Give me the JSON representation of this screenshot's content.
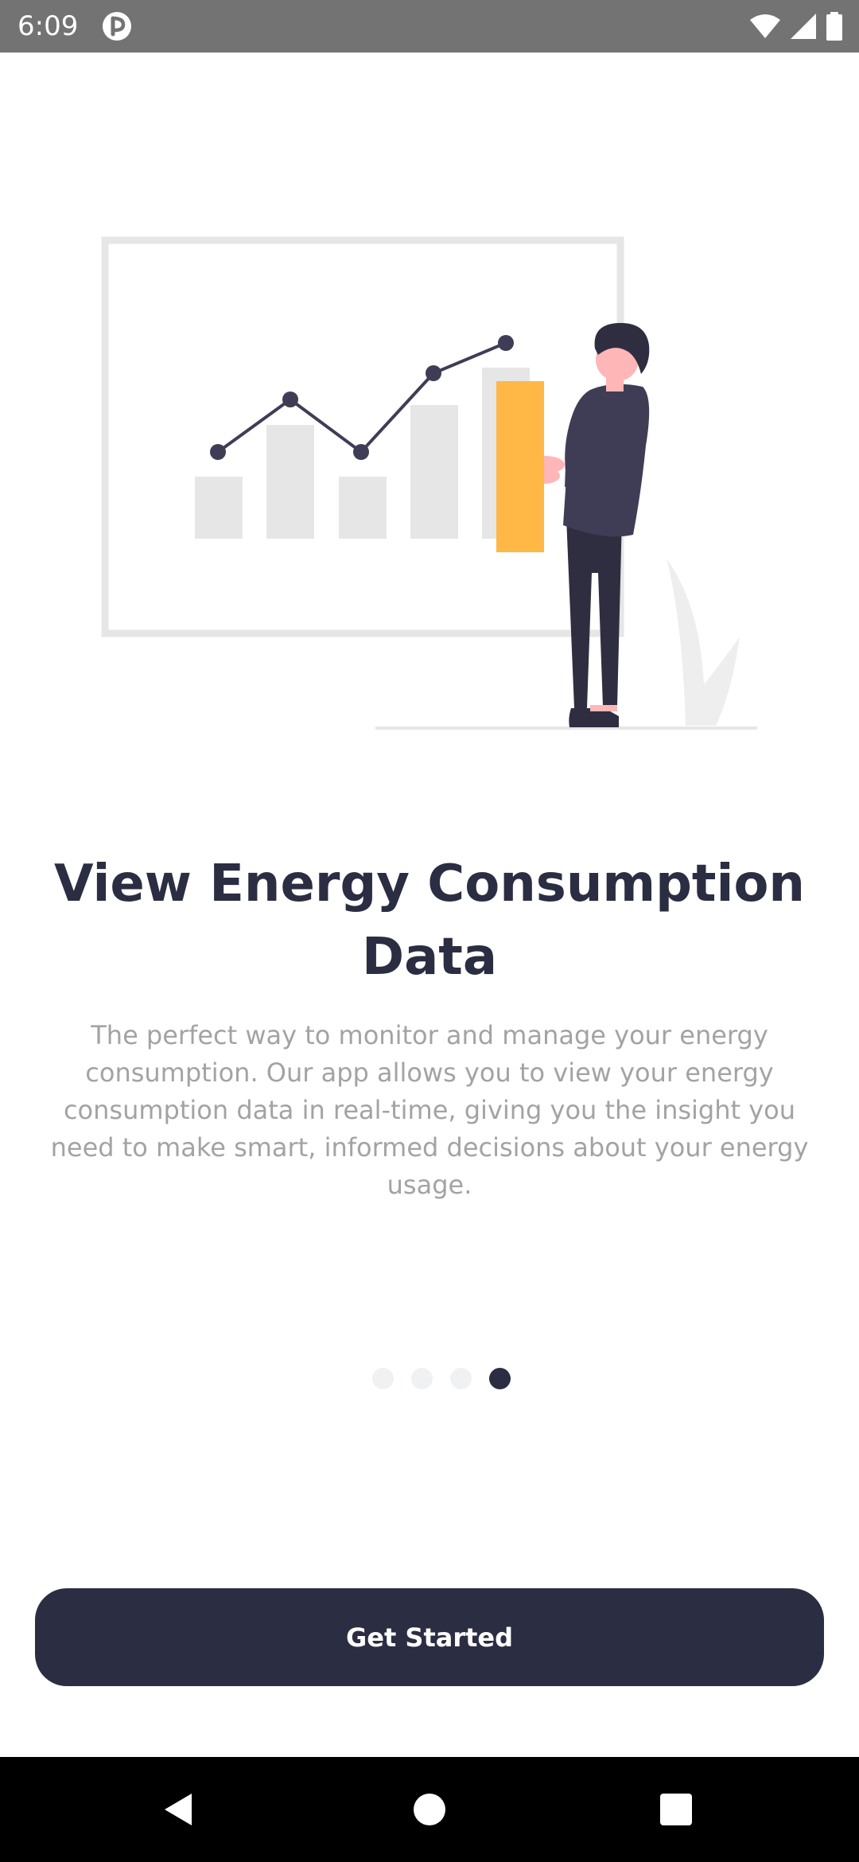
{
  "status_bar": {
    "time": "6:09",
    "icons": [
      "app-notification-icon",
      "wifi-icon",
      "signal-icon",
      "battery-icon"
    ]
  },
  "illustration": {
    "name": "analytics-presentation-illustration",
    "colors": {
      "frame": "#e6e6e6",
      "bars": "#e6e6e6",
      "line": "#3f3d56",
      "highlight_bar": "#ffb846",
      "person_dark": "#2f2e41",
      "skin": "#ffb6b6"
    }
  },
  "onboarding": {
    "title": "View Energy Consumption Data",
    "description": "The perfect way to monitor and manage your energy consumption. Our app allows you to view your energy consumption data in real-time, giving you the insight you need to make smart, informed decisions about your energy usage.",
    "page_count": 4,
    "active_page": 4,
    "cta_label": "Get Started"
  },
  "colors": {
    "primary": "#2b2d42",
    "description_text": "#a3a3a3",
    "inactive_dot": "#f0f1f3",
    "status_bar": "#737373"
  },
  "nav_bar": {
    "buttons": [
      "back-icon",
      "home-icon",
      "recents-icon"
    ]
  }
}
